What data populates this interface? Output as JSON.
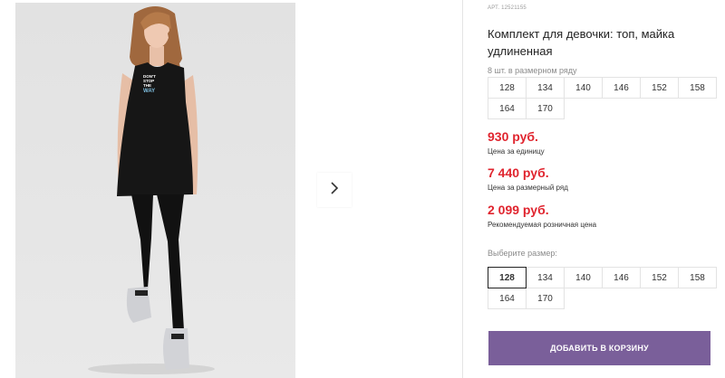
{
  "product": {
    "article": "АРТ. 12521155",
    "title": "Комплект для девочки: топ, майка удлиненная",
    "pack_note": "8 шт. в размерном ряду",
    "sizes_row": [
      "128",
      "134",
      "140",
      "146",
      "152",
      "158",
      "164",
      "170"
    ]
  },
  "prices": {
    "unit_price": "930 руб.",
    "unit_label": "Цена за единицу",
    "pack_price": "7 440 руб.",
    "pack_label": "Цена за размерный ряд",
    "retail_price": "2 099 руб.",
    "retail_label": "Рекомендуемая розничная цена"
  },
  "size_select": {
    "label": "Выберите размер:",
    "options": [
      "128",
      "134",
      "140",
      "146",
      "152",
      "158",
      "164",
      "170"
    ],
    "selected": "128"
  },
  "cart_button": "ДОБАВИТЬ В КОРЗИНУ",
  "gallery": {
    "next_icon": "chevron-right-icon",
    "shirt_print": [
      "DON'T",
      "STOP",
      "THE",
      "WAY"
    ]
  },
  "colors": {
    "price": "#e0252f",
    "button": "#7a5f9a"
  }
}
